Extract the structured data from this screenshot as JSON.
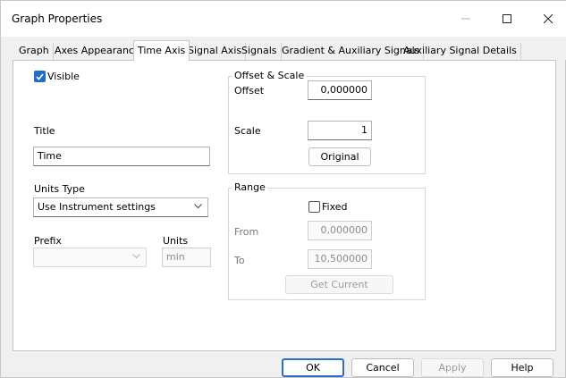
{
  "window": {
    "title": "Graph Properties",
    "minimize_icon": "minimize-icon",
    "maximize_icon": "maximize-icon",
    "close_icon": "close-icon"
  },
  "tabs": [
    {
      "label": "Graph",
      "active": false
    },
    {
      "label": "Axes Appearance",
      "active": false
    },
    {
      "label": "Time Axis",
      "active": true
    },
    {
      "label": "Signal Axis",
      "active": false
    },
    {
      "label": "Signals",
      "active": false
    },
    {
      "label": "Gradient & Auxiliary Signals",
      "active": false
    },
    {
      "label": "Auxiliary Signal Details",
      "active": false
    }
  ],
  "left": {
    "visible_label": "Visible",
    "visible_checked": true,
    "title_label": "Title",
    "title_value": "Time",
    "units_type_label": "Units Type",
    "units_type_value": "Use Instrument settings",
    "prefix_label": "Prefix",
    "prefix_value": "",
    "units_label": "Units",
    "units_value": "min"
  },
  "offset_scale": {
    "group_title": "Offset & Scale",
    "offset_label": "Offset",
    "offset_value": "0,000000",
    "scale_label": "Scale",
    "scale_value": "1",
    "original_button": "Original"
  },
  "range": {
    "group_title": "Range",
    "fixed_label": "Fixed",
    "fixed_checked": false,
    "from_label": "From",
    "from_value": "0,000000",
    "to_label": "To",
    "to_value": "10,500000",
    "get_current_button": "Get Current"
  },
  "footer": {
    "ok": "OK",
    "cancel": "Cancel",
    "apply": "Apply",
    "help": "Help"
  },
  "colors": {
    "accent": "#1f6ec9",
    "default_button_border": "#2b6fc4"
  }
}
